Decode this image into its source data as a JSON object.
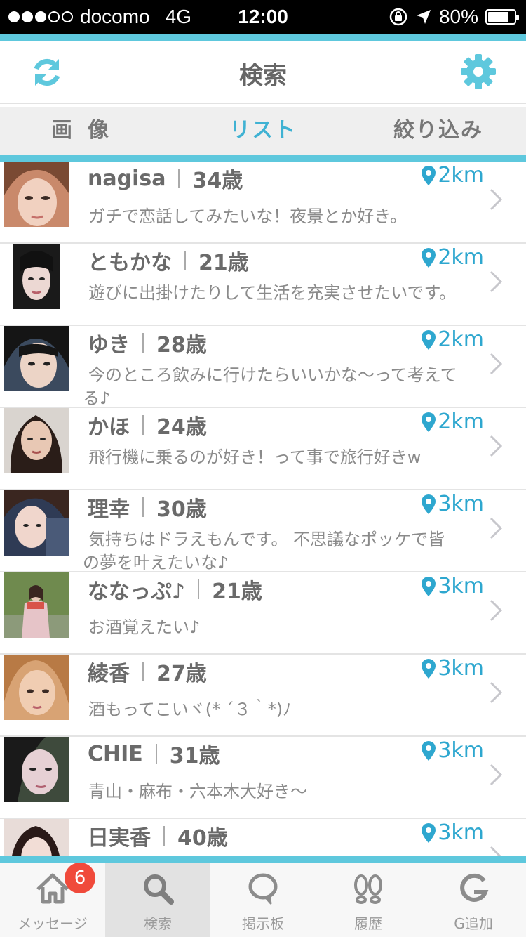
{
  "status_bar": {
    "carrier": "docomo",
    "network": "4G",
    "time": "12:00",
    "battery": "80%",
    "battery_level": 0.8
  },
  "header": {
    "title": "検索",
    "left_icon": "refresh-icon",
    "right_icon": "gear-icon"
  },
  "tabs": [
    {
      "label": "画像",
      "active": false
    },
    {
      "label": "リスト",
      "active": true
    },
    {
      "label": "絞り込み",
      "active": false
    }
  ],
  "users": [
    {
      "name": "nagisa",
      "age": "34歳",
      "distance": "2km",
      "message": "ガチで恋話してみたいな！夜景とか好き。"
    },
    {
      "name": "ともかな",
      "age": "21歳",
      "distance": "2km",
      "message": "遊びに出掛けたりして生活を充実させたいです。"
    },
    {
      "name": "ゆき",
      "age": "28歳",
      "distance": "2km",
      "message": "今のところ飲みに行けたらいいかな〜って考えてる♪"
    },
    {
      "name": "かほ",
      "age": "24歳",
      "distance": "2km",
      "message": "飛行機に乗るのが好き！って事で旅行好きw"
    },
    {
      "name": "理幸",
      "age": "30歳",
      "distance": "3km",
      "message": "気持ちはドラえもんです。 不思議なポッケで皆の夢を叶えたいな♪"
    },
    {
      "name": "ななっぷ♪",
      "age": "21歳",
      "distance": "3km",
      "message": "お酒覚えたい♪"
    },
    {
      "name": "綾香",
      "age": "27歳",
      "distance": "3km",
      "message": "酒もってこいヾ(* ´３｀*)ﾉ"
    },
    {
      "name": "CHIE",
      "age": "31歳",
      "distance": "3km",
      "message": "青山・麻布・六本木大好き〜"
    },
    {
      "name": "日実香",
      "age": "40歳",
      "distance": "3km",
      "message": ""
    }
  ],
  "bottom_nav": [
    {
      "label": "メッセージ",
      "icon": "home-icon",
      "badge": "6"
    },
    {
      "label": "検索",
      "icon": "search-icon",
      "active": true
    },
    {
      "label": "掲示板",
      "icon": "speech-bubble-icon"
    },
    {
      "label": "履歴",
      "icon": "footprints-icon"
    },
    {
      "label": "G追加",
      "icon": "g-icon"
    }
  ],
  "colors": {
    "accent": "#5ec8dd",
    "active_tab": "#3fb2d3",
    "distance": "#2ea7cf",
    "badge": "#f04a3b"
  }
}
